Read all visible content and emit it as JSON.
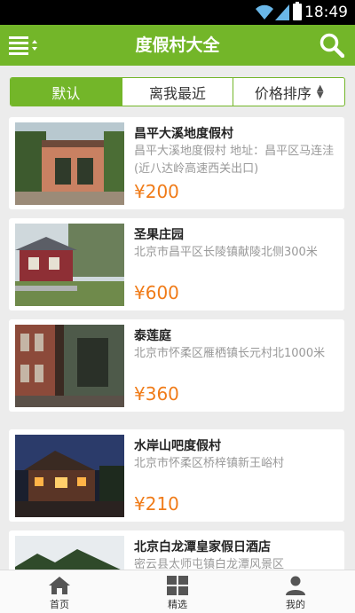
{
  "status_bar": {
    "time": "18:49"
  },
  "header": {
    "title": "度假村大全"
  },
  "tabs": [
    {
      "label": "默认"
    },
    {
      "label": "离我最近"
    },
    {
      "label": "价格排序"
    }
  ],
  "resorts": [
    {
      "name": "昌平大溪地度假村",
      "description": "昌平大溪地度假村 地址：昌平区马连洼(近八达岭高速西关出口)",
      "price": "¥200"
    },
    {
      "name": "圣果庄园",
      "description": "北京市昌平区长陵镇献陵北侧300米",
      "price": "¥600"
    },
    {
      "name": "泰莲庭",
      "description": "北京市怀柔区雁栖镇长元村北1000米",
      "price": "¥360"
    },
    {
      "name": "水岸山吧度假村",
      "description": "北京市怀柔区桥梓镇新王峪村",
      "price": "¥210"
    },
    {
      "name": "北京白龙潭皇家假日酒店",
      "description": "密云县太师屯镇白龙潭风景区",
      "price": ""
    }
  ],
  "bottom_nav": [
    {
      "label": "首页",
      "icon": "home-icon"
    },
    {
      "label": "精选",
      "icon": "grid-icon"
    },
    {
      "label": "我的",
      "icon": "user-icon"
    }
  ],
  "colors": {
    "brand_green": "#73b629",
    "price_orange": "#f07b18"
  }
}
